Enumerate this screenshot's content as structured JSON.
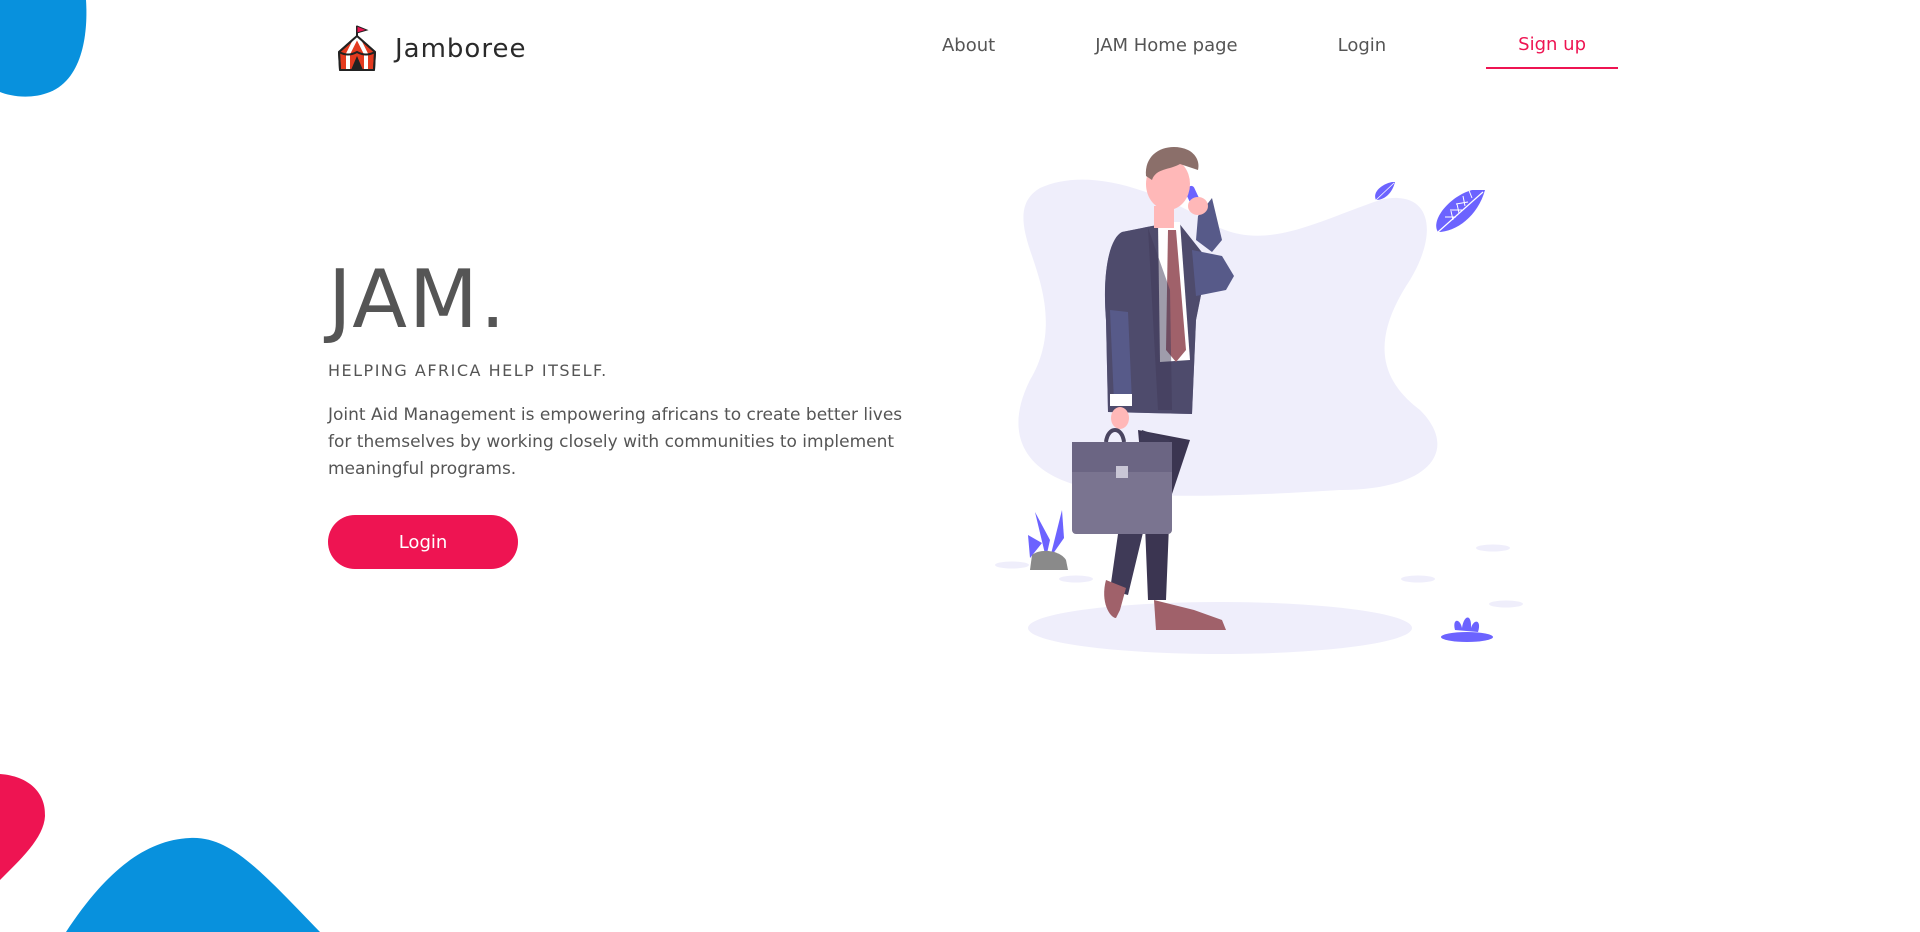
{
  "header": {
    "brand_name": "Jamboree",
    "nav": [
      {
        "label": "About"
      },
      {
        "label": "JAM Home page"
      },
      {
        "label": "Login"
      },
      {
        "label": "Sign up",
        "active": true
      }
    ]
  },
  "hero": {
    "title": "JAM.",
    "tagline": "HELPING AFRICA HELP ITSELF.",
    "description": "Joint Aid Management is empowering africans to create better lives for themselves by working closely with communities to implement meaningful programs.",
    "cta_label": "Login"
  },
  "colors": {
    "accent": "#ee1452",
    "blob_blue": "#0891dd",
    "blob_red": "#ee1452",
    "text": "#555555",
    "illustration_bg": "#efeefb",
    "illustration_purple": "#6c63ff"
  },
  "icons": {
    "brand_logo": "circus-tent-icon"
  }
}
